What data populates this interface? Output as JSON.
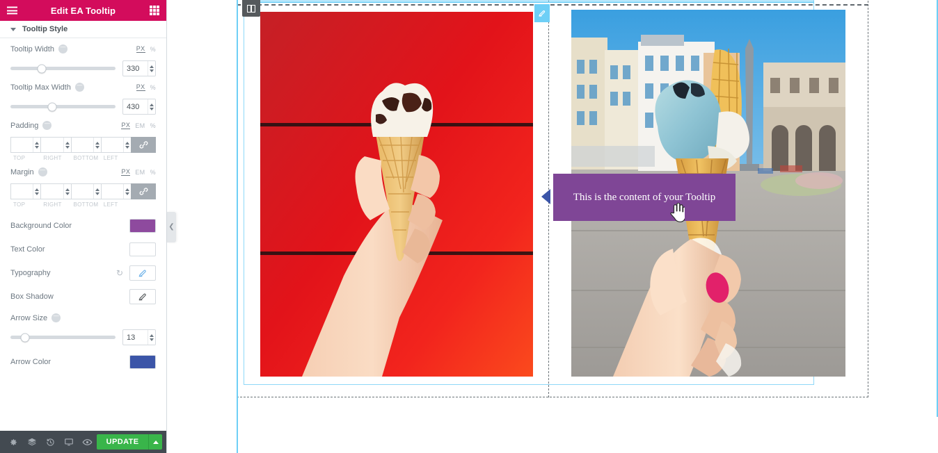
{
  "panel": {
    "header": {
      "title": "Edit EA Tooltip",
      "menu_icon": "hamburger-icon",
      "grid_icon": "widgets-grid-icon",
      "bg_color": "#d30c5c"
    },
    "section": {
      "title": "Tooltip Style",
      "expanded": true
    },
    "controls": {
      "tooltip_width": {
        "label": "Tooltip Width",
        "value": "330",
        "units": [
          "PX",
          "%"
        ],
        "active_unit": "PX",
        "slider_percent": 30
      },
      "tooltip_max_width": {
        "label": "Tooltip Max Width",
        "value": "430",
        "units": [
          "PX",
          "%"
        ],
        "active_unit": "PX",
        "slider_percent": 40
      },
      "padding": {
        "label": "Padding",
        "units": [
          "PX",
          "EM",
          "%"
        ],
        "active_unit": "PX",
        "values": [
          "",
          "",
          "",
          ""
        ],
        "sides": [
          "TOP",
          "RIGHT",
          "BOTTOM",
          "LEFT"
        ],
        "linked": true,
        "link_icon": "link-icon"
      },
      "margin": {
        "label": "Margin",
        "units": [
          "PX",
          "EM",
          "%"
        ],
        "active_unit": "PX",
        "values": [
          "",
          "",
          "",
          ""
        ],
        "sides": [
          "TOP",
          "RIGHT",
          "BOTTOM",
          "LEFT"
        ],
        "linked": true,
        "link_icon": "link-icon"
      },
      "background_color": {
        "label": "Background Color",
        "color": "#8e4a9e"
      },
      "text_color": {
        "label": "Text Color",
        "color": "#ffffff"
      },
      "typography": {
        "label": "Typography",
        "reset_icon": "reset-icon",
        "edit_icon": "pencil-icon"
      },
      "box_shadow": {
        "label": "Box Shadow",
        "edit_icon": "pencil-icon"
      },
      "arrow_size": {
        "label": "Arrow Size",
        "value": "13",
        "slider_percent": 14
      },
      "arrow_color": {
        "label": "Arrow Color",
        "color": "#3b55a8"
      }
    },
    "footer": {
      "icons": [
        "settings-gear-icon",
        "layers-navigator-icon",
        "history-revisions-icon",
        "responsive-preview-icon",
        "eye-preview-icon"
      ],
      "update_label": "UPDATE",
      "update_caret_icon": "caret-up-icon",
      "update_color": "#39b54a"
    }
  },
  "collapse_tab": {
    "icon": "chevron-left-icon"
  },
  "canvas": {
    "section_handle_icon": "column-handle-icon",
    "edit_badge_icon": "pencil-edit-icon",
    "accent_outline_color": "#8ed8f8",
    "left_image_alt": "hand holding vanilla chocolate-chunk ice cream cone against red wall",
    "right_image_alt": "hand holding blue ice cream cone in italian piazza",
    "tooltip": {
      "text": "This is the content of your Tooltip",
      "background_color": "#7f4696",
      "text_color": "#ffffff",
      "arrow_color": "#3b55a8"
    },
    "cursor_icon": "pointing-hand-cursor"
  }
}
